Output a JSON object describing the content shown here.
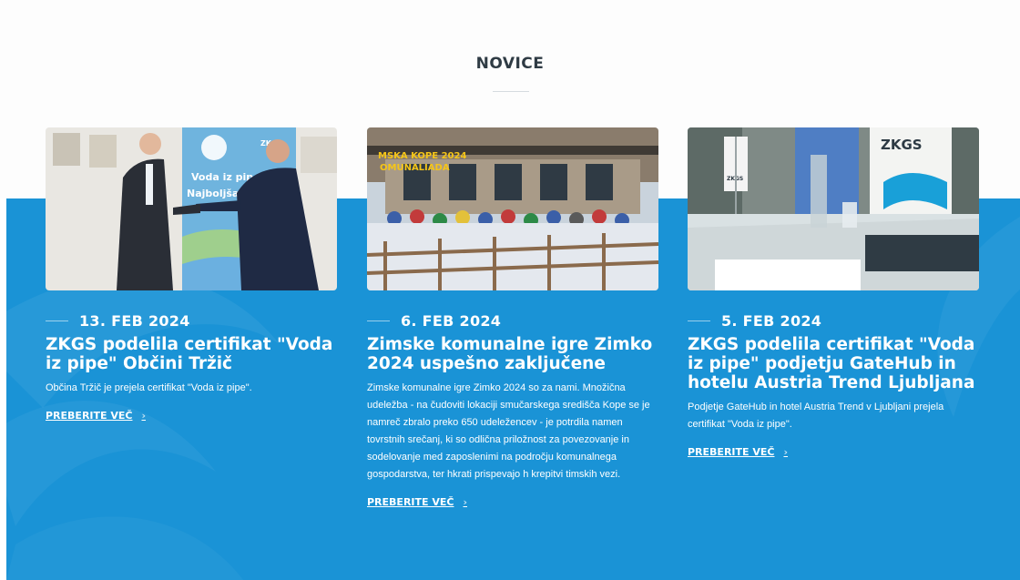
{
  "section": {
    "title": "NOVICE"
  },
  "news": [
    {
      "date": "13. FEB 2024",
      "title": "ZKGS podelila certifikat \"Voda iz pipe\" Občini Tržič",
      "excerpt": "Občina Tržič je prejela certifikat \"Voda iz pipe\".",
      "read_more": "PREBERITE VEČ",
      "image_text": {
        "line1": "Voda iz pipe.",
        "line2": "Najboljša iz",
        "logo": "ZKGS"
      }
    },
    {
      "date": "6. FEB 2024",
      "title": "Zimske komunalne igre Zimko 2024 uspešno zaključene",
      "excerpt": "Zimske komunalne igre Zimko 2024 so za nami. Množična udeležba - na čudoviti lokaciji smučarskega središča Kope se je namreč zbralo preko 650 udeležencev - je potrdila namen tovrstnih srečanj, ki so odlična priložnost za povezovanje in sodelovanje med zaposlenimi na področju komunalnega gospodarstva, ter hkrati prispevajo h krepitvi timskih vezi.",
      "read_more": "PREBERITE VEČ",
      "image_text": {
        "line1": "MSKA KOPE 2024",
        "line2": "OMUNALIADA"
      }
    },
    {
      "date": "5. FEB 2024",
      "title": "ZKGS podelila certifikat \"Voda iz pipe\" podjetju GateHub in hotelu Austria Trend Ljubljana",
      "excerpt": "Podjetje GateHub in hotel Austria Trend v Ljubljani prejela certifikat \"Voda iz pipe\".",
      "read_more": "PREBERITE VEČ",
      "image_text": {
        "banner": "ZKGS",
        "flag": "ZKGS"
      }
    }
  ],
  "colors": {
    "blue": "#1a93d6",
    "title": "#2f3b44"
  },
  "icons": {
    "read_more": "chevron-right-icon"
  }
}
